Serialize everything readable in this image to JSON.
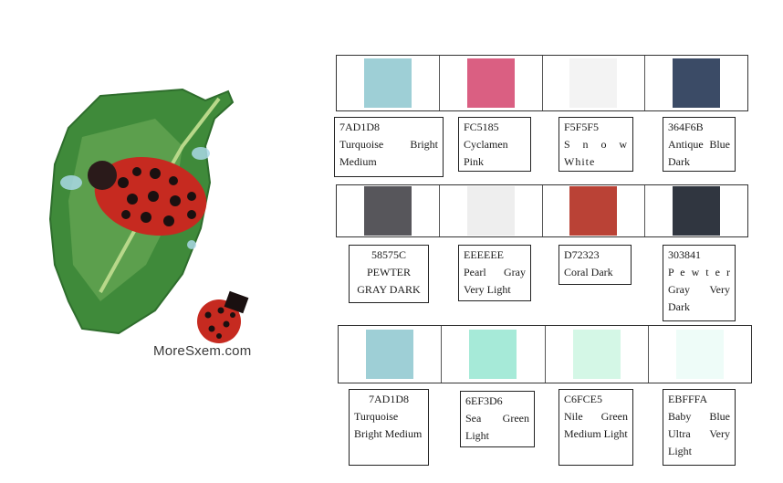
{
  "watermark": "MoreSxem.com",
  "swatches": [
    {
      "code": "7AD1D8",
      "name": "Turquoise Bright Medium",
      "color": "#9ECFD6"
    },
    {
      "code": "FC5185",
      "name": "Cyclamen Pink",
      "color": "#DA5F82"
    },
    {
      "code": "F5F5F5",
      "name": "S n o w White",
      "color": "#F3F3F3"
    },
    {
      "code": "364F6B",
      "name": "Antique Blue Dark",
      "color": "#3B4B66"
    },
    {
      "code": "58575C",
      "name": "PEWTER GRAY DARK",
      "color": "#57565B"
    },
    {
      "code": "EEEEEE",
      "name": "Pearl Gray Very Light",
      "color": "#EEEEEE"
    },
    {
      "code": "D72323",
      "name": "Coral Dark",
      "color": "#BA4236"
    },
    {
      "code": "303841",
      "name": "P e w t e r Gray Very Dark",
      "color": "#303640"
    },
    {
      "code": "7AD1D8",
      "name": "Turquoise Bright Medium",
      "color": "#9ECFD6"
    },
    {
      "code": "6EF3D6",
      "name": "Sea Green Light",
      "color": "#A6EAD8"
    },
    {
      "code": "C6FCE5",
      "name": "Nile Green Medium Light",
      "color": "#D4F7E6"
    },
    {
      "code": "EBFFFA",
      "name": "Baby Blue Ultra Very Light",
      "color": "#EEFCF8"
    }
  ]
}
